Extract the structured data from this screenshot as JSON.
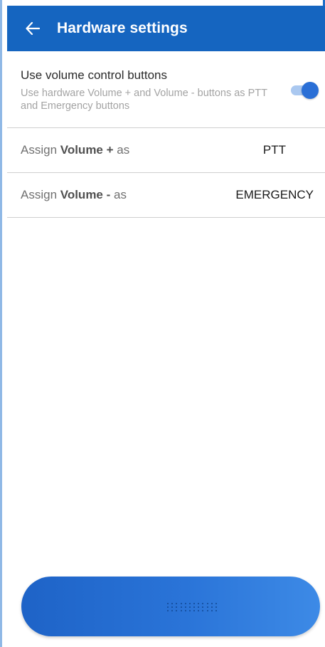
{
  "app_bar": {
    "title": "Hardware settings",
    "back_icon": "arrow-left-icon",
    "background": "#1565c0"
  },
  "settings": {
    "volume_toggle": {
      "title": "Use volume control buttons",
      "description": "Use hardware Volume + and Volume - buttons as PTT and Emergency buttons",
      "enabled": true,
      "accent": "#2a6fd6"
    },
    "assign_plus": {
      "prefix": "Assign ",
      "bold": "Volume +",
      "suffix": " as",
      "value": "PTT"
    },
    "assign_minus": {
      "prefix": "Assign ",
      "bold": "Volume -",
      "suffix": " as",
      "value": "EMERGENCY"
    }
  },
  "ptt_button": {
    "icon": "speaker-grille-icon",
    "color": "#2a74d8"
  }
}
